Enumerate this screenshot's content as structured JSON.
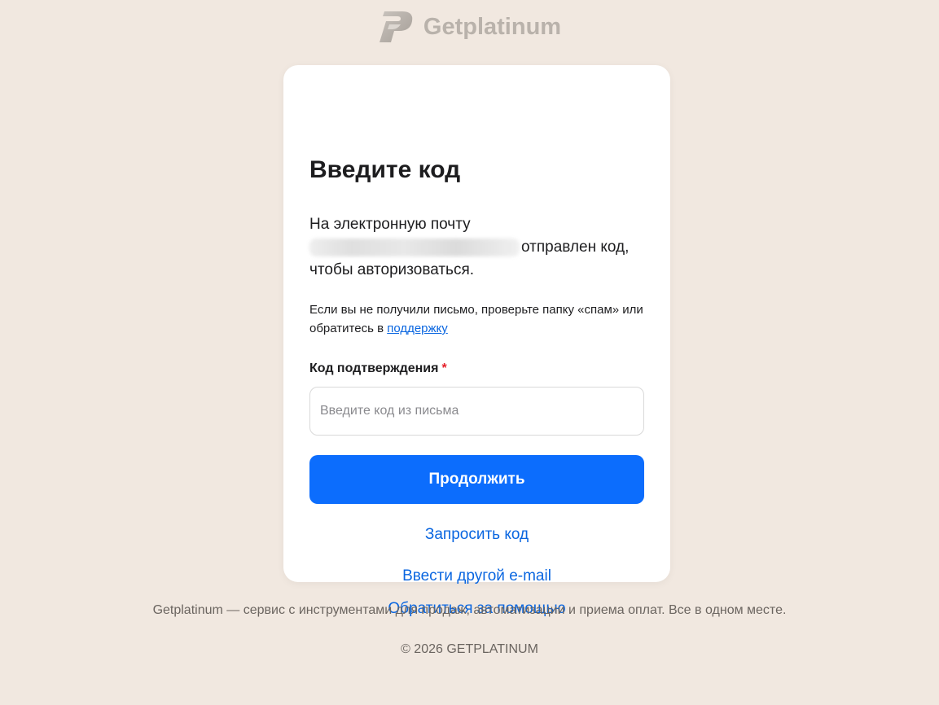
{
  "brand": {
    "name": "Getplatinum",
    "logo_icon": "getplatinum-logo-icon"
  },
  "card": {
    "title": "Введите код",
    "intro_line1": "На электронную почту",
    "intro_line2_suffix": "отправлен код,",
    "intro_line3": "чтобы авторизоваться.",
    "hint_text": "Если вы не получили письмо, проверьте папку «спам» или обратитесь в ",
    "hint_link": "поддержку",
    "field_label": "Код подтверждения",
    "field_required_mark": "*",
    "code_placeholder": "Введите код из письма",
    "code_value": "",
    "continue_label": "Продолжить",
    "request_code_label": "Запросить код",
    "other_email_label": "Ввести другой e-mail",
    "help_label": "Обратиться за помощью"
  },
  "footer": {
    "description": "Getplatinum — сервис с инструментами для продаж, автоматизации и приема оплат. Все в одном месте.",
    "copyright": "© 2026 GETPLATINUM"
  },
  "colors": {
    "background": "#f1e8e0",
    "accent": "#0c6dfd",
    "link": "#0a66e0",
    "required": "#e5202a"
  }
}
